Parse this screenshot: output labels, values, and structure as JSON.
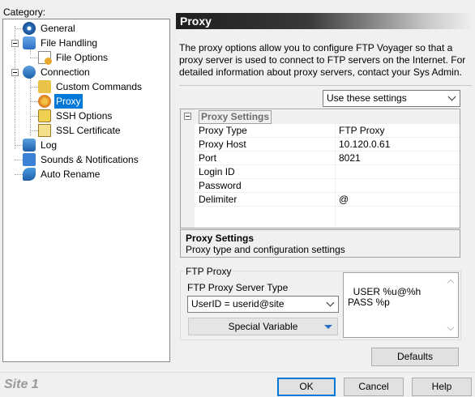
{
  "category_label": "Category:",
  "tree": [
    {
      "label": "General",
      "icon": "gear-icon"
    },
    {
      "label": "File Handling",
      "icon": "file-handling-icon"
    },
    {
      "label": "File Options",
      "icon": "file-options-icon"
    },
    {
      "label": "Connection",
      "icon": "connection-icon"
    },
    {
      "label": "Custom Commands",
      "icon": "custom-commands-icon"
    },
    {
      "label": "Proxy",
      "icon": "proxy-icon",
      "selected": true
    },
    {
      "label": "SSH Options",
      "icon": "ssh-icon"
    },
    {
      "label": "SSL Certificate",
      "icon": "certificate-icon"
    },
    {
      "label": "Log",
      "icon": "log-icon"
    },
    {
      "label": "Sounds & Notifications",
      "icon": "sound-icon"
    },
    {
      "label": "Auto Rename",
      "icon": "rename-icon"
    }
  ],
  "header": {
    "title": "Proxy"
  },
  "description": "The proxy options allow you to configure FTP Voyager so that a proxy server is used to connect to FTP servers on the Internet. For detailed information about proxy servers, contact your Sys Admin.",
  "settings_mode": {
    "selected": "Use these settings"
  },
  "property_grid": {
    "category": "Proxy Settings",
    "rows": [
      {
        "name": "Proxy Type",
        "value": "FTP Proxy"
      },
      {
        "name": "Proxy Host",
        "value": "10.120.0.61"
      },
      {
        "name": "Port",
        "value": "8021"
      },
      {
        "name": "Login ID",
        "value": ""
      },
      {
        "name": "Password",
        "value": ""
      },
      {
        "name": "Delimiter",
        "value": "@"
      }
    ],
    "help_title": "Proxy Settings",
    "help_text": "Proxy type and configuration settings"
  },
  "ftp_proxy": {
    "group_label": "FTP Proxy",
    "server_type_label": "FTP Proxy Server Type",
    "server_type_value": "UserID = userid@site",
    "special_variable_label": "Special Variable",
    "commands": "USER %u@%h\nPASS %p"
  },
  "buttons": {
    "defaults": "Defaults",
    "ok": "OK",
    "cancel": "Cancel",
    "help": "Help"
  },
  "site_label": "Site 1",
  "colors": {
    "selection": "#0078d7",
    "header_dark": "#1e1e1e"
  }
}
